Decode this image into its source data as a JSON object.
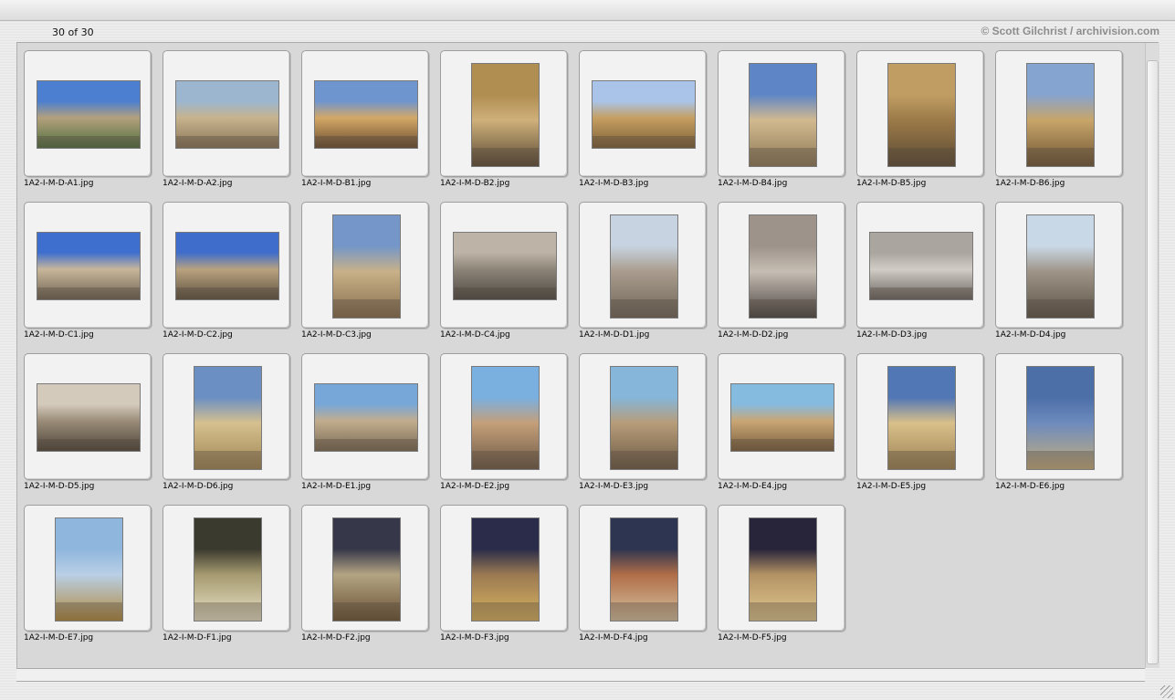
{
  "header": {
    "count_label": "30 of 30",
    "credit": "© Scott Gilchrist / archivision.com"
  },
  "images": [
    {
      "filename": "1A2-I-M-D-A1.jpg",
      "orientation": "landscape",
      "colors": [
        "#4c7fd0",
        "#b3a07c",
        "#4f7040"
      ]
    },
    {
      "filename": "1A2-I-M-D-A2.jpg",
      "orientation": "landscape",
      "colors": [
        "#9cb6d0",
        "#c7b38d",
        "#8a7559"
      ]
    },
    {
      "filename": "1A2-I-M-D-B1.jpg",
      "orientation": "landscape",
      "colors": [
        "#6f95cf",
        "#d4a867",
        "#6a4d30"
      ]
    },
    {
      "filename": "1A2-I-M-D-B2.jpg",
      "orientation": "portrait",
      "colors": [
        "#b08d51",
        "#cfb07a",
        "#5a4a35"
      ]
    },
    {
      "filename": "1A2-I-M-D-B3.jpg",
      "orientation": "landscape",
      "colors": [
        "#a9c4e8",
        "#c59f62",
        "#7d6038"
      ]
    },
    {
      "filename": "1A2-I-M-D-B4.jpg",
      "orientation": "portrait",
      "colors": [
        "#5e86c6",
        "#d2b98f",
        "#8d7a57"
      ]
    },
    {
      "filename": "1A2-I-M-D-B5.jpg",
      "orientation": "portrait",
      "colors": [
        "#c09e63",
        "#9c7a48",
        "#5b4a34"
      ]
    },
    {
      "filename": "1A2-I-M-D-B6.jpg",
      "orientation": "portrait",
      "colors": [
        "#86a4d0",
        "#c8a569",
        "#6e5535"
      ]
    },
    {
      "filename": "1A2-I-M-D-C1.jpg",
      "orientation": "landscape",
      "colors": [
        "#3f6fce",
        "#c8b69a",
        "#6e6353"
      ]
    },
    {
      "filename": "1A2-I-M-D-C2.jpg",
      "orientation": "landscape",
      "colors": [
        "#3e6dcb",
        "#b9a27f",
        "#5f5240"
      ]
    },
    {
      "filename": "1A2-I-M-D-C3.jpg",
      "orientation": "portrait",
      "colors": [
        "#7496c8",
        "#c8b188",
        "#866e4c"
      ]
    },
    {
      "filename": "1A2-I-M-D-C4.jpg",
      "orientation": "landscape",
      "colors": [
        "#bdb4a7",
        "#8d8478",
        "#4e4a44"
      ]
    },
    {
      "filename": "1A2-I-M-D-D1.jpg",
      "orientation": "portrait",
      "colors": [
        "#c7d3e0",
        "#a99c8d",
        "#6f6558"
      ]
    },
    {
      "filename": "1A2-I-M-D-D2.jpg",
      "orientation": "portrait",
      "colors": [
        "#9d938a",
        "#c6bdb3",
        "#4a4440"
      ]
    },
    {
      "filename": "1A2-I-M-D-D3.jpg",
      "orientation": "landscape",
      "colors": [
        "#aaa59f",
        "#d1ccc6",
        "#6a655f"
      ]
    },
    {
      "filename": "1A2-I-M-D-D4.jpg",
      "orientation": "portrait",
      "colors": [
        "#c9d8e6",
        "#9e9487",
        "#5c5448"
      ]
    },
    {
      "filename": "1A2-I-M-D-D5.jpg",
      "orientation": "landscape",
      "colors": [
        "#d4cabc",
        "#9a8c78",
        "#4f463b"
      ]
    },
    {
      "filename": "1A2-I-M-D-D6.jpg",
      "orientation": "portrait",
      "colors": [
        "#6b8fc3",
        "#d6c08f",
        "#a08654"
      ]
    },
    {
      "filename": "1A2-I-M-D-E1.jpg",
      "orientation": "landscape",
      "colors": [
        "#77a7d8",
        "#c2ad8e",
        "#7a6a55"
      ]
    },
    {
      "filename": "1A2-I-M-D-E2.jpg",
      "orientation": "portrait",
      "colors": [
        "#7ab0e0",
        "#c49f79",
        "#6e5a46"
      ]
    },
    {
      "filename": "1A2-I-M-D-E3.jpg",
      "orientation": "portrait",
      "colors": [
        "#86b6d9",
        "#b79c79",
        "#6c5a45"
      ]
    },
    {
      "filename": "1A2-I-M-D-E4.jpg",
      "orientation": "landscape",
      "colors": [
        "#86bbe0",
        "#c9a675",
        "#7a5f3d"
      ]
    },
    {
      "filename": "1A2-I-M-D-E5.jpg",
      "orientation": "portrait",
      "colors": [
        "#5277b5",
        "#d9c08a",
        "#9c8153"
      ]
    },
    {
      "filename": "1A2-I-M-D-E6.jpg",
      "orientation": "portrait",
      "colors": [
        "#4d6fa8",
        "#6d8bbd",
        "#c5ae7c"
      ]
    },
    {
      "filename": "1A2-I-M-D-E7.jpg",
      "orientation": "portrait",
      "colors": [
        "#8fb6dd",
        "#b9cfe6",
        "#b08a3e"
      ]
    },
    {
      "filename": "1A2-I-M-D-F1.jpg",
      "orientation": "portrait",
      "colors": [
        "#3b3a2e",
        "#a59a70",
        "#e8e2c6"
      ]
    },
    {
      "filename": "1A2-I-M-D-F2.jpg",
      "orientation": "portrait",
      "colors": [
        "#36384a",
        "#b3a482",
        "#6a5234"
      ]
    },
    {
      "filename": "1A2-I-M-D-F3.jpg",
      "orientation": "portrait",
      "colors": [
        "#2a2c4a",
        "#9b7a52",
        "#d9b35f"
      ]
    },
    {
      "filename": "1A2-I-M-D-F4.jpg",
      "orientation": "portrait",
      "colors": [
        "#2e3550",
        "#b06d48",
        "#d6c2a0"
      ]
    },
    {
      "filename": "1A2-I-M-D-F5.jpg",
      "orientation": "portrait",
      "colors": [
        "#28243a",
        "#b39264",
        "#e0c98f"
      ]
    }
  ]
}
